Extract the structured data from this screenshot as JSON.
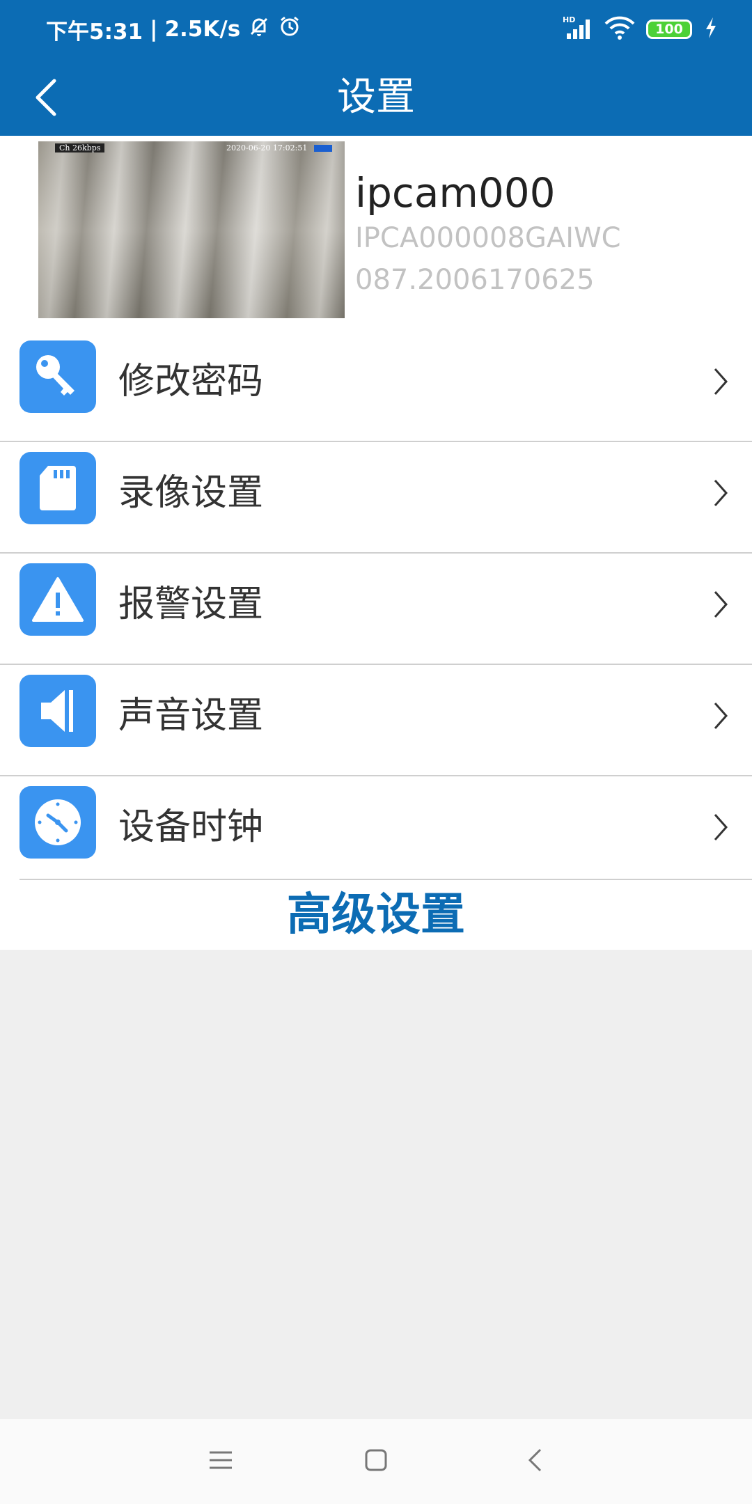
{
  "status_bar": {
    "time": "下午5:31",
    "net_speed": "2.5K/s",
    "battery": "100",
    "signal_label": "HD"
  },
  "app_bar": {
    "title": "设置"
  },
  "device": {
    "name": "ipcam000",
    "uid": "IPCA000008GAIWC",
    "version": "087.2006170625",
    "preview_osd_left": "Ch 26kbps",
    "preview_osd_time": "2020-06-20  17:02:51"
  },
  "menu": {
    "items": [
      {
        "label": "修改密码",
        "icon": "key-icon"
      },
      {
        "label": "录像设置",
        "icon": "sd-card-icon"
      },
      {
        "label": "报警设置",
        "icon": "warning-icon"
      },
      {
        "label": "声音设置",
        "icon": "speaker-icon"
      },
      {
        "label": "设备时钟",
        "icon": "clock-icon"
      }
    ]
  },
  "advanced": {
    "label": "高级设置"
  },
  "colors": {
    "primary": "#0c6cb4",
    "icon_bg": "#3a94f0",
    "background": "#efefef"
  }
}
